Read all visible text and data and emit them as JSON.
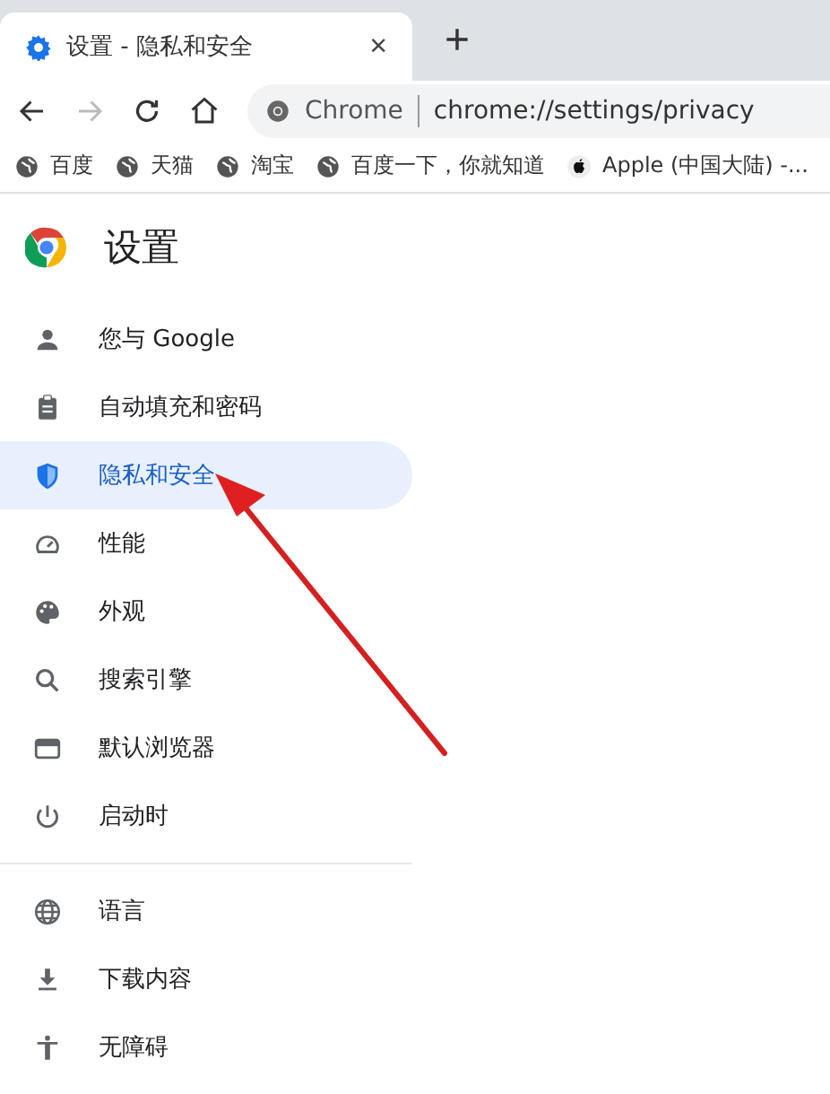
{
  "tabs": [
    {
      "title": "设置 - 隐私和安全",
      "selected": true,
      "close": "×"
    }
  ],
  "new_tab": "+",
  "toolbar": {
    "forward_disabled": true,
    "site_chip": "Chrome",
    "url": "chrome://settings/privacy"
  },
  "bookmarks": [
    {
      "label": "百度",
      "kind": "globe"
    },
    {
      "label": "天猫",
      "kind": "globe"
    },
    {
      "label": "淘宝",
      "kind": "globe"
    },
    {
      "label": "百度一下，你就知道",
      "kind": "globe"
    },
    {
      "label": "Apple (中国大陆) -...",
      "kind": "apple"
    }
  ],
  "settings": {
    "title": "设置",
    "groups": [
      {
        "items": [
          {
            "label": "您与 Google",
            "selected": false
          },
          {
            "label": "自动填充和密码",
            "selected": false
          },
          {
            "label": "隐私和安全",
            "selected": true
          },
          {
            "label": "性能",
            "selected": false
          },
          {
            "label": "外观",
            "selected": false
          },
          {
            "label": "搜索引擎",
            "selected": false
          },
          {
            "label": "默认浏览器",
            "selected": false
          },
          {
            "label": "启动时",
            "selected": false
          }
        ]
      },
      {
        "items": [
          {
            "label": "语言",
            "selected": false
          },
          {
            "label": "下载内容",
            "selected": false
          },
          {
            "label": "无障碍",
            "selected": false
          }
        ]
      }
    ]
  },
  "annotation": {
    "kind": "arrow"
  }
}
